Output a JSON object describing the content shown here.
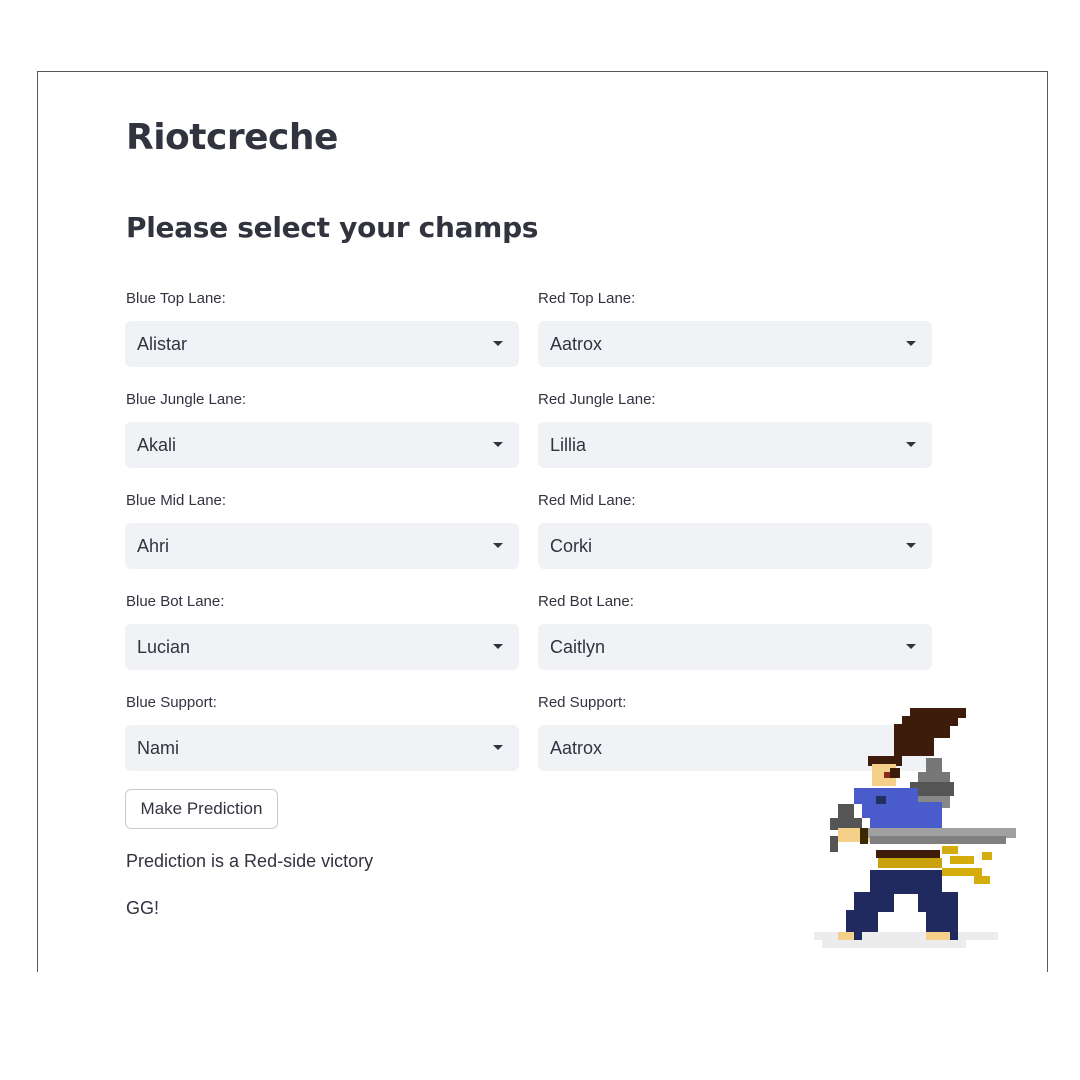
{
  "app": {
    "title": "Riotcreche"
  },
  "form": {
    "heading": "Please select your champs",
    "blue": [
      {
        "label": "Blue Top Lane:",
        "value": "Alistar"
      },
      {
        "label": "Blue Jungle Lane:",
        "value": "Akali"
      },
      {
        "label": "Blue Mid Lane:",
        "value": "Ahri"
      },
      {
        "label": "Blue Bot Lane:",
        "value": "Lucian"
      },
      {
        "label": "Blue Support:",
        "value": "Nami"
      }
    ],
    "red": [
      {
        "label": "Red Top Lane:",
        "value": "Aatrox"
      },
      {
        "label": "Red Jungle Lane:",
        "value": "Lillia"
      },
      {
        "label": "Red Mid Lane:",
        "value": "Corki"
      },
      {
        "label": "Red Bot Lane:",
        "value": "Caitlyn"
      },
      {
        "label": "Red Support:",
        "value": "Aatrox"
      }
    ],
    "predict_button": "Make Prediction"
  },
  "result": {
    "prediction": "Prediction is a Red-side victory",
    "closing": "GG!"
  },
  "decoration": {
    "sprite_icon": "pixel-swordsman-icon"
  }
}
